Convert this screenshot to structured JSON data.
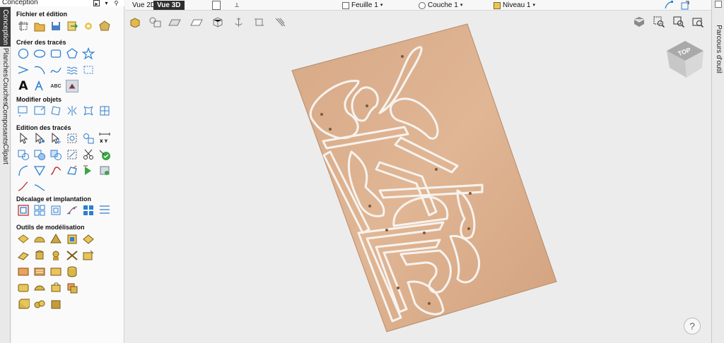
{
  "panel": {
    "title": "Conception",
    "tabs": [
      "Conception",
      "Planches",
      "Couches",
      "Composants",
      "Clipart"
    ],
    "sections": [
      "Fichier et édition",
      "Créer des tracés",
      "Modifier objets",
      "Edition des tracés",
      "Décalage et implantation",
      "Outils de modélisation"
    ],
    "text_icon_labels": {
      "big_a": "A",
      "abc": "ABC"
    }
  },
  "toolbar": {
    "view_2d": "Vue 2D",
    "view_3d": "Vue 3D",
    "sheet": "Feuille 1",
    "layer": "Couche 1",
    "level": "Niveau 1"
  },
  "viewport": {
    "cube_label": "TOP",
    "help": "?"
  },
  "right_panel": {
    "title": "Parcours d'outil"
  },
  "colors": {
    "wood": "#d9aa87",
    "active_tab": "#2e2e2e",
    "accent_icon": "#2d7fd1"
  }
}
